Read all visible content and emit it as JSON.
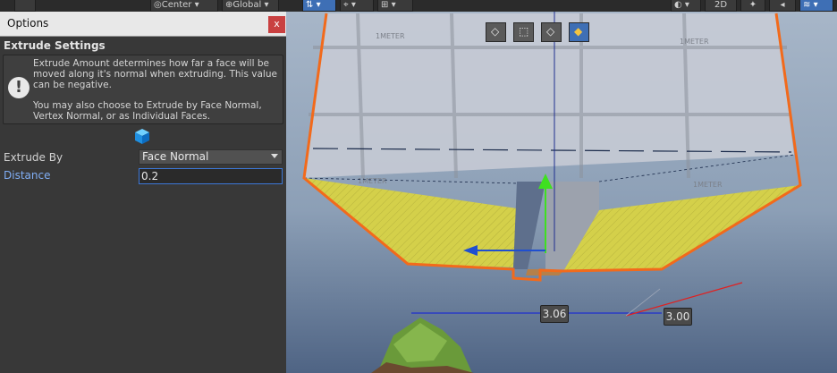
{
  "toolbar": {
    "pivot_label": "Center",
    "space_label": "Global",
    "mode_2d": "2D"
  },
  "options": {
    "window_title": "Options",
    "close_label": "x",
    "section_title": "Extrude Settings",
    "help_icon_glyph": "!",
    "help_text_1": "Extrude Amount determines how far a face will be moved along it's normal when extruding.  This value can be negative.",
    "help_text_2": "You may also choose to Extrude by Face Normal, Vertex Normal, or as Individual Faces.",
    "extrude_by_label": "Extrude By",
    "extrude_by_value": "Face Normal",
    "distance_label": "Distance",
    "distance_value": "0.2"
  },
  "scene": {
    "grid_label": "1METER",
    "measure_1": "3.06",
    "measure_2": "3.00"
  },
  "colors": {
    "accent": "#3e6fb5",
    "selection_outline": "#f26a1b",
    "face_yellow": "#d4d04a",
    "close_red": "#c94040"
  }
}
